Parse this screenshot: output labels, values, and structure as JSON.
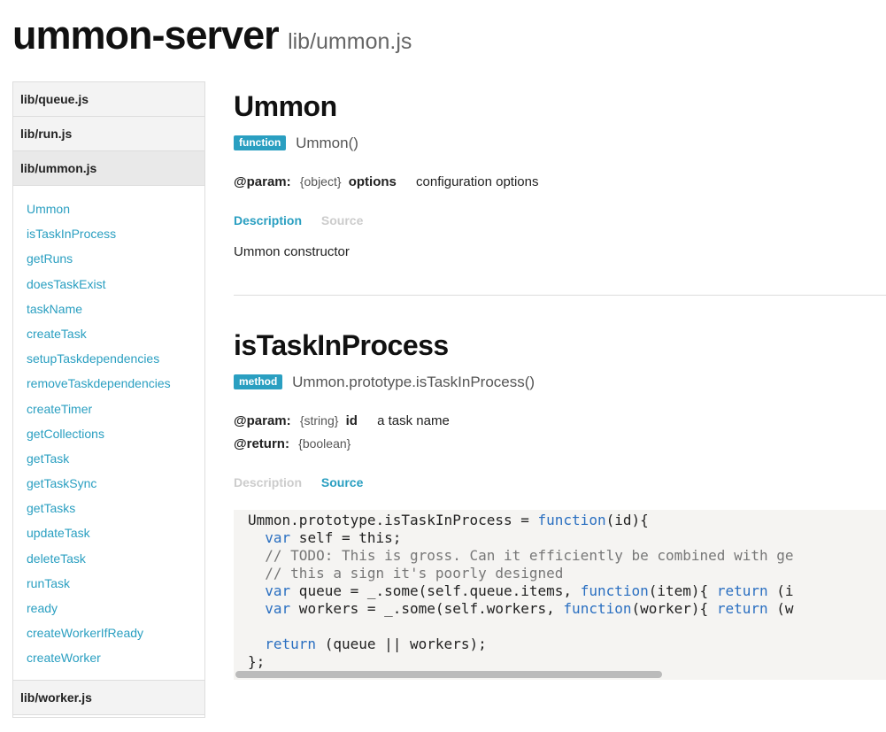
{
  "header": {
    "project": "ummon-server",
    "file": "lib/ummon.js"
  },
  "sidebar": {
    "files_top": [
      "lib/queue.js",
      "lib/run.js",
      "lib/ummon.js"
    ],
    "items": [
      "Ummon",
      "isTaskInProcess",
      "getRuns",
      "doesTaskExist",
      "taskName",
      "createTask",
      "setupTaskdependencies",
      "removeTaskdependencies",
      "createTimer",
      "getCollections",
      "getTask",
      "getTaskSync",
      "getTasks",
      "updateTask",
      "deleteTask",
      "runTask",
      "ready",
      "createWorkerIfReady",
      "createWorker"
    ],
    "files_bottom": [
      "lib/worker.js"
    ]
  },
  "sections": [
    {
      "title": "Ummon",
      "badge": "function",
      "signature": "Ummon()",
      "params": [
        {
          "tag": "@param:",
          "type": "{object}",
          "name": "options",
          "desc": "configuration options"
        }
      ],
      "tabs": {
        "description": "Description",
        "source": "Source"
      },
      "description": "Ummon constructor"
    },
    {
      "title": "isTaskInProcess",
      "badge": "method",
      "signature": "Ummon.prototype.isTaskInProcess()",
      "params": [
        {
          "tag": "@param:",
          "type": "{string}",
          "name": "id",
          "desc": "a task name"
        },
        {
          "tag": "@return:",
          "type": "{boolean}",
          "name": "",
          "desc": ""
        }
      ],
      "tabs": {
        "description": "Description",
        "source": "Source"
      },
      "code": [
        "Ummon.prototype.isTaskInProcess = function(id){",
        "  var self = this;",
        "  // TODO: This is gross. Can it efficiently be combined with ge",
        "  // this a sign it's poorly designed",
        "  var queue = _.some(self.queue.items, function(item){ return (i",
        "  var workers = _.some(self.workers, function(worker){ return (w",
        "",
        "  return (queue || workers);",
        "};"
      ]
    }
  ]
}
